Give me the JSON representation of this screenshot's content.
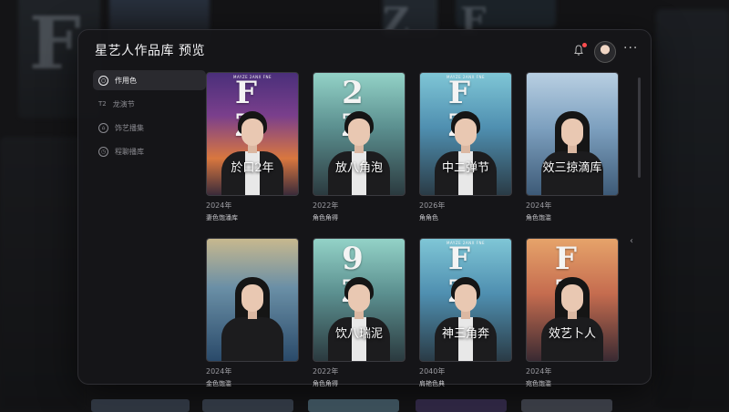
{
  "app": {
    "title": "星艺人作品库 预览"
  },
  "sidebar": {
    "items": [
      {
        "label": "作用色",
        "icon": "circle-icon",
        "active": true
      },
      {
        "label": "龙演节",
        "icon": "tag-icon",
        "active": false
      },
      {
        "label": "饰艺播集",
        "icon": "circle-icon",
        "active": false
      },
      {
        "label": "程聊播库",
        "icon": "circle-icon",
        "active": false
      }
    ]
  },
  "header": {
    "more": "···"
  },
  "works": [
    {
      "big": "F Z",
      "cap": "MAYZE 2ANX FNE",
      "caption": "於口2年",
      "year": "2024年",
      "role": "妻色饱潘库",
      "theme": "purple",
      "person": "man"
    },
    {
      "big": "2 Z",
      "cap": "",
      "caption": "放八角泡",
      "year": "2022年",
      "role": "角色角得",
      "theme": "teal",
      "person": "man"
    },
    {
      "big": "F Z",
      "cap": "MAYZE 2ANX FNE",
      "caption": "中二弹节",
      "year": "2026年",
      "role": "角角色",
      "theme": "sky",
      "person": "man"
    },
    {
      "big": "",
      "cap": "",
      "caption": "效三掠滴库",
      "year": "2024年",
      "role": "角色饱滥",
      "theme": "sky2",
      "person": "woman"
    },
    {
      "big": "",
      "cap": "",
      "caption": "",
      "year": "2024年",
      "role": "金色饱滥",
      "theme": "sea",
      "person": "woman"
    },
    {
      "big": "9 Z",
      "cap": "",
      "caption": "饮八瑞泥",
      "year": "2022年",
      "role": "角色角得",
      "theme": "teal",
      "person": "man"
    },
    {
      "big": "F Z",
      "cap": "MAYZE 2ANX FNE",
      "caption": "神三角奔",
      "year": "2040年",
      "role": "肩艳色典",
      "theme": "sky",
      "person": "man"
    },
    {
      "big": "F Z",
      "cap": "",
      "caption": "效艺卜人",
      "year": "2024年",
      "role": "宛色饱滥",
      "theme": "sunset",
      "person": "woman"
    }
  ],
  "colors": {
    "purple": "linear-gradient(180deg,#4a2f7a 0%,#7a3f8c 35%,#d9773f 70%,#3b2b3a 100%)",
    "teal": "linear-gradient(180deg,#93d2c7 0%,#5b8f8f 45%,#2b3a3f 100%)",
    "sky": "linear-gradient(180deg,#7fc6d6 0%,#4f8fb0 45%,#2a3b46 100%)",
    "sky2": "linear-gradient(180deg,#b8cfe2 0%,#7da0bf 45%,#3d5a77 100%)",
    "sea": "linear-gradient(180deg,#c7b88e 0%,#6a8fa6 40%,#2a4a6a 100%)",
    "sunset": "linear-gradient(180deg,#e6a36a 0%,#c56c4f 45%,#3a2a32 100%)"
  }
}
